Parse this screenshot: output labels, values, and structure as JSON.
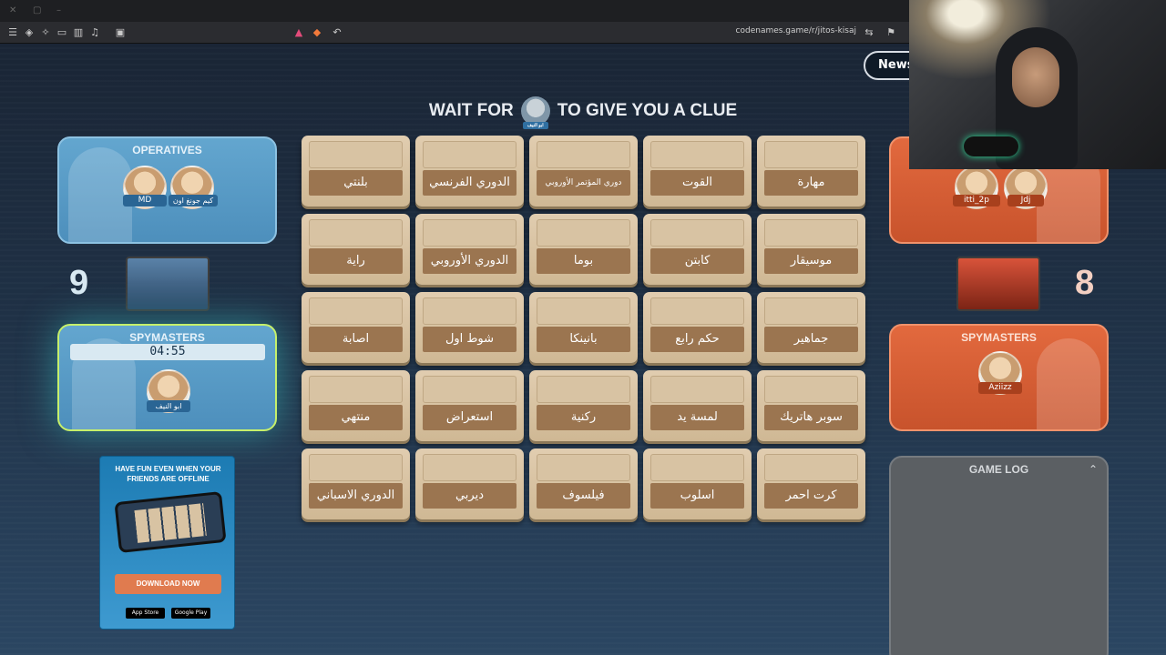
{
  "browser": {
    "url": "codenames.game/r/jitos-kisaj"
  },
  "header": {
    "news_label": "News",
    "clue_prefix": "WAIT FOR",
    "clue_suffix": "TO GIVE YOU A CLUE",
    "clue_avatar_tag": "ابو النيف"
  },
  "blue_team": {
    "operatives_title": "OPERATIVES",
    "operatives": [
      {
        "name": "MD"
      },
      {
        "name": "كيم جونغ اون"
      }
    ],
    "score": "9",
    "spymasters_title": "SPYMASTERS",
    "timer": "04:55",
    "spymasters": [
      {
        "name": "ابو النيف"
      }
    ]
  },
  "red_team": {
    "operatives": [
      {
        "name": "itti_2p"
      },
      {
        "name": "Jdj"
      }
    ],
    "score": "8",
    "spymasters_title": "SPYMASTERS",
    "spymasters": [
      {
        "name": "Aziizz"
      }
    ]
  },
  "board": {
    "cards": [
      "بلنتي",
      "الدوري الفرنسي",
      "دوري المؤتمر الأوروبي",
      "القوت",
      "مهارة",
      "راية",
      "الدوري الأوروبي",
      "بوما",
      "كابتن",
      "موسيقار",
      "اصابة",
      "شوط اول",
      "بانينكا",
      "حكم رابع",
      "جماهير",
      "منتهي",
      "استعراض",
      "ركنية",
      "لمسة يد",
      "سوبر هاتريك",
      "الدوري الاسباني",
      "ديربي",
      "فيلسوف",
      "اسلوب",
      "كرت احمر"
    ]
  },
  "ad": {
    "title": "HAVE FUN EVEN WHEN YOUR FRIENDS ARE OFFLINE",
    "download_label": "DOWNLOAD NOW",
    "app_store_label": "App Store",
    "google_play_label": "Google Play"
  },
  "game_log": {
    "title": "GAME LOG"
  },
  "icons": {
    "menu": "menu-icon",
    "shield": "shield-icon",
    "bookmark": "bookmark-icon",
    "chevron": "chevron-up-icon"
  },
  "colors": {
    "blue_team": "#4d8fbc",
    "red_team": "#c8532c",
    "card": "#d8c3a3",
    "card_word": "#9b7550"
  }
}
